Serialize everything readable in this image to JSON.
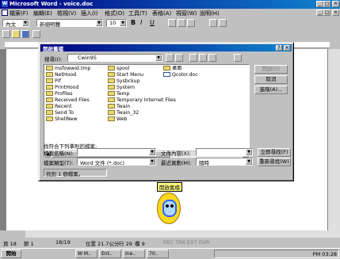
{
  "window": {
    "title": "Microsoft Word - voice.doc"
  },
  "menu": [
    "檔案(F)",
    "編輯(E)",
    "檢視(V)",
    "插入(I)",
    "格式(O)",
    "工具(T)",
    "表格(A)",
    "視窗(W)",
    "說明(H)"
  ],
  "format_bar": {
    "style": "內文",
    "font": "新細明體",
    "size": "10"
  },
  "dialog": {
    "title": "開啟舊檔",
    "lookin_label": "搜尋(I):",
    "lookin_value": "Cwin95",
    "files_col1": [
      "msfowwid.tmp",
      "NetHood",
      "Pif",
      "PrintHood",
      "Profiles",
      "Received Files",
      "Recent",
      "Send To",
      "ShellNew"
    ],
    "files_col2": [
      "spool",
      "Start Menu",
      "Sysbckup",
      "System",
      "Temp",
      "Temporary Internet Files",
      "Twain",
      "Twain_32",
      "Web"
    ],
    "files_col3": [
      "桌面",
      "Qcolor.doc"
    ],
    "buttons": [
      "開啟(O)",
      "取消",
      "進階(A)..."
    ],
    "criteria_label": "找符合下列準則的檔案:",
    "filename_label": "檔案名稱(N):",
    "filename_value": "",
    "filetype_label": "檔案類型(T):",
    "filetype_value": "Word 文件 (*.doc)",
    "text_label": "文件內容(X):",
    "text_value": "",
    "modified_label": "最近異動(M):",
    "modified_value": "隨時",
    "find_button": "立即尋找(F)",
    "new_search_button": "重新尋找(W)",
    "found_text": "找到 1 個檔案。"
  },
  "assistant": {
    "label": "開啟舊檔"
  },
  "statusbar": {
    "page": "頁 18",
    "section": "節 1",
    "pages": "18/19",
    "pos": "位置 21.7公分",
    "line": "行 29",
    "col": "欄 9",
    "modes": "REC TRK EXT OVR"
  },
  "taskbar": {
    "start": "開始",
    "tasks": [
      "W M..",
      "Ent..",
      "Ine..",
      "70.."
    ],
    "clock": "PM 03:28"
  }
}
